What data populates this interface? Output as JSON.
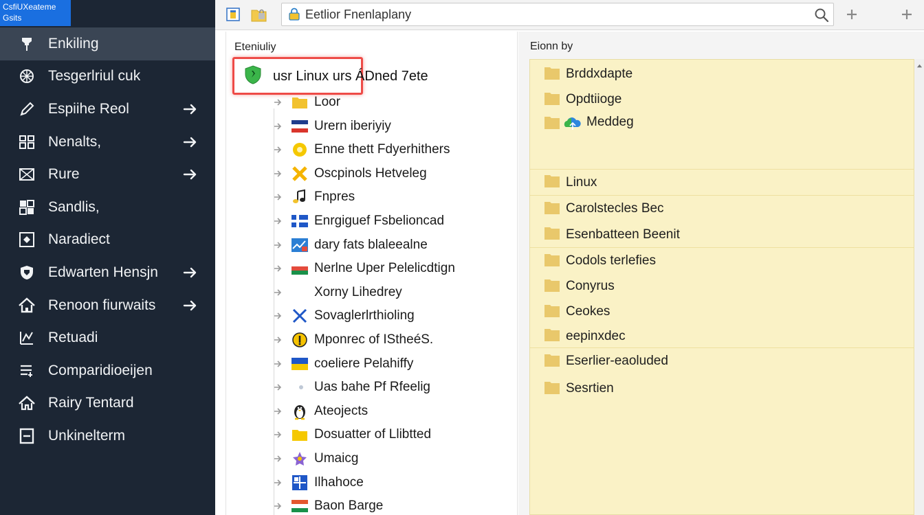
{
  "logo": {
    "line1": "CsfiUXeateme",
    "line2": "Gsits"
  },
  "sidebar": {
    "items": [
      {
        "label": "Enkiling",
        "icon": "pin-icon",
        "arrow": false,
        "active": true
      },
      {
        "label": "Tesgerlriul cuk",
        "icon": "grid-globe-icon",
        "arrow": false,
        "active": false
      },
      {
        "label": "Espiihe Reol",
        "icon": "pencil-icon",
        "arrow": true,
        "active": false
      },
      {
        "label": "Nenalts,",
        "icon": "people-icon",
        "arrow": true,
        "active": false
      },
      {
        "label": "Rure",
        "icon": "envelope-icon",
        "arrow": true,
        "active": false
      },
      {
        "label": "Sandlis,",
        "icon": "blocks-icon",
        "arrow": false,
        "active": false
      },
      {
        "label": "Naradiect",
        "icon": "diamond-box-icon",
        "arrow": false,
        "active": false
      },
      {
        "label": "Edwarten Hensjn",
        "icon": "shield-icon",
        "arrow": true,
        "active": false
      },
      {
        "label": "Renoon fiurwaits",
        "icon": "home-icon",
        "arrow": true,
        "active": false
      },
      {
        "label": "Retuadi",
        "icon": "chart-icon",
        "arrow": false,
        "active": false
      },
      {
        "label": "Comparidioeijen",
        "icon": "list-icon",
        "arrow": false,
        "active": false
      },
      {
        "label": "Rairy Tentard",
        "icon": "house-icon",
        "arrow": false,
        "active": false
      },
      {
        "label": "Unkinelterm",
        "icon": "window-icon",
        "arrow": false,
        "active": false
      }
    ]
  },
  "toolbar": {
    "search_value": "Eetlior Fnenlaplany"
  },
  "tree": {
    "title": "Eteniuliy",
    "root_label": "usr Linux urs ÁDned 7ete",
    "items": [
      {
        "label": "Loor",
        "icon": "folder-icon",
        "color": "#f2c22e"
      },
      {
        "label": "Urern iberiyiy",
        "icon": "flag-icon",
        "color": "#d9352c"
      },
      {
        "label": "Enne thett Fdyerhithers",
        "icon": "circle-icon",
        "color": "#f5c800"
      },
      {
        "label": "Oscpinols Hetveleg",
        "icon": "x-mark-icon",
        "color": "#f5b400"
      },
      {
        "label": "Fnpres",
        "icon": "music-icon",
        "color": "#222222"
      },
      {
        "label": "Enrgiguef Fsbelioncad",
        "icon": "flag-cross-icon",
        "color": "#1f57c7"
      },
      {
        "label": "dary fats blaleealne",
        "icon": "chart-line-icon",
        "color": "#2b7fd4"
      },
      {
        "label": "Nerlne Uper Pelelicdtign",
        "icon": "flag-stripes-icon",
        "color": "#19914a"
      },
      {
        "label": "Xorny Lihedrey",
        "icon": "crescent-icon",
        "color": "#1a8fd6"
      },
      {
        "label": "Sovaglerlrthioling",
        "icon": "cross-icon",
        "color": "#1f57c7"
      },
      {
        "label": "Mponrec of IStheéS.",
        "icon": "coin-icon",
        "color": "#f5c200"
      },
      {
        "label": "coeliere Pelahiffy",
        "icon": "flag-blue-yellow-icon",
        "color": "#1f57c7"
      },
      {
        "label": "Uas bahe Pf Rfeelig",
        "icon": "crescent-alt-icon",
        "color": "#e6b84b"
      },
      {
        "label": "Ateojects",
        "icon": "penguin-icon",
        "color": "#222222"
      },
      {
        "label": "Dosuatter of Llibtted",
        "icon": "folder-icon",
        "color": "#f5c800"
      },
      {
        "label": "Umaicg",
        "icon": "star-icon",
        "color": "#8a63d2"
      },
      {
        "label": "Ilhahoce",
        "icon": "grid-icon",
        "color": "#1f57c7"
      },
      {
        "label": "Baon Barge",
        "icon": "flag-tricolor-icon",
        "color": "#e4572e"
      }
    ]
  },
  "list": {
    "title": "Eionn by",
    "items": [
      {
        "label": "Brddxdapte"
      },
      {
        "label": "Opdtiioge"
      },
      {
        "label": "Meddeg"
      },
      {
        "label": "Linux"
      },
      {
        "label": "Carolstecles Bec"
      },
      {
        "label": "Esenbatteen Beenit"
      },
      {
        "label": "Codols terlefies"
      },
      {
        "label": "Conyrus"
      },
      {
        "label": "Ceokes"
      },
      {
        "label": "eepinxdec"
      },
      {
        "label": "Eserlier-eaoluded"
      },
      {
        "label": "Sesrtien"
      }
    ]
  },
  "colors": {
    "sidebar_bg": "#1c2634",
    "sidebar_active": "#3a4554",
    "logo_bg": "#1a6fe0",
    "highlight": "#ee4b47",
    "list_bg": "#faf2c6",
    "folder": "#e9c86b"
  }
}
